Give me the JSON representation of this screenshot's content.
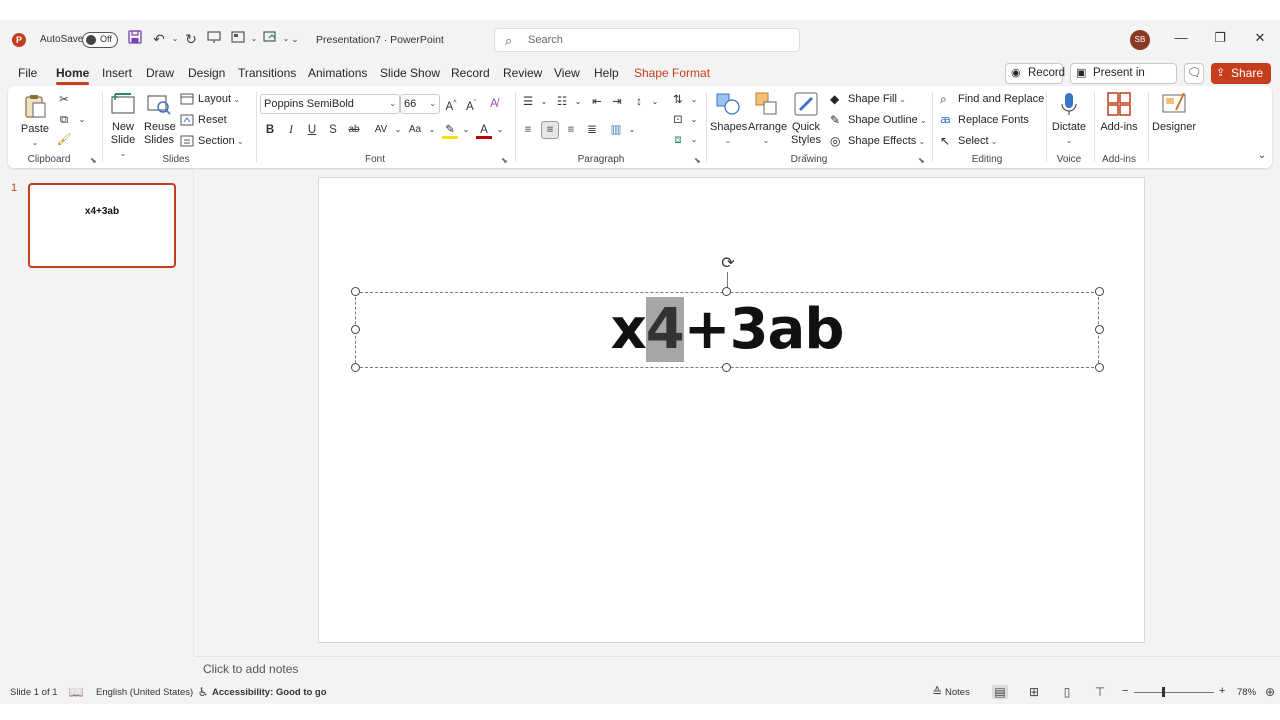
{
  "app": {
    "autosave_label": "AutoSave",
    "autosave_state": "Off",
    "doc_title": "Presentation7  ·  PowerPoint",
    "search_placeholder": "Search",
    "user_initials": "SB"
  },
  "tabs": [
    "File",
    "Home",
    "Insert",
    "Draw",
    "Design",
    "Transitions",
    "Animations",
    "Slide Show",
    "Record",
    "Review",
    "View",
    "Help",
    "Shape Format"
  ],
  "header_buttons": {
    "record": "Record",
    "present_in_teams": "Present in Teams",
    "share": "Share"
  },
  "ribbon": {
    "clipboard": {
      "label": "Clipboard",
      "paste": "Paste"
    },
    "slides": {
      "label": "Slides",
      "new_slide": "New Slide",
      "new_slide_l1": "New",
      "new_slide_l2": "Slide",
      "reuse_l1": "Reuse",
      "reuse_l2": "Slides",
      "layout": "Layout",
      "reset": "Reset",
      "section": "Section"
    },
    "font": {
      "label": "Font",
      "family": "Poppins SemiBold",
      "size": "66"
    },
    "paragraph": {
      "label": "Paragraph"
    },
    "drawing": {
      "label": "Drawing",
      "shapes": "Shapes",
      "arrange": "Arrange",
      "quick_l1": "Quick",
      "quick_l2": "Styles",
      "shape_fill": "Shape Fill",
      "shape_outline": "Shape Outline",
      "shape_effects": "Shape Effects"
    },
    "editing": {
      "label": "Editing",
      "find_replace": "Find and Replace",
      "replace_fonts": "Replace Fonts",
      "select": "Select"
    },
    "voice": {
      "label": "Voice",
      "dictate": "Dictate"
    },
    "addins": {
      "label": "Add-ins",
      "addins": "Add-ins"
    },
    "designer": {
      "designer": "Designer"
    }
  },
  "slides_panel": {
    "slide_number": "1",
    "thumb_text": "x4+3ab"
  },
  "slide": {
    "text_before": "x",
    "text_selected": "4",
    "text_after": "+3ab"
  },
  "notes": {
    "placeholder": "Click to add notes"
  },
  "status": {
    "slide_of": "Slide 1 of 1",
    "language": "English (United States)",
    "accessibility": "Accessibility: Good to go",
    "notes": "Notes",
    "zoom": "78%"
  },
  "colors": {
    "accent": "#c43e1c",
    "selection": "#a6a6a6"
  }
}
